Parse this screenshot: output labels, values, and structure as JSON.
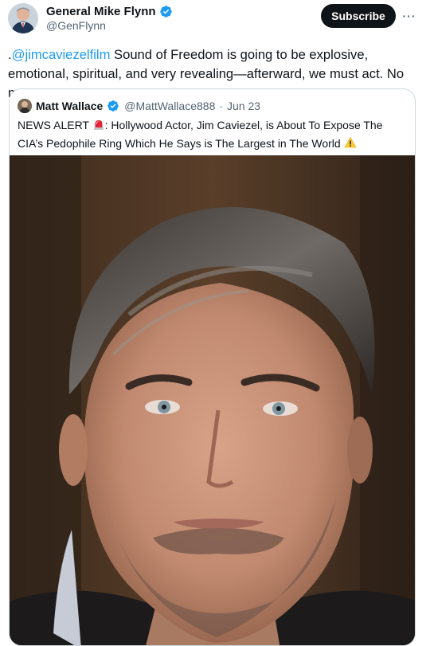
{
  "author": {
    "name": "General Mike Flynn",
    "handle": "@GenFlynn"
  },
  "actions": {
    "subscribe_label": "Subscribe",
    "more_label": "···"
  },
  "tweet": {
    "prefix": ".",
    "mention": "@jimcaviezelfilm",
    "body": " Sound of Freedom is going to be explosive, emotional, spiritual, and very revealing—afterward, we must act. No more excuses."
  },
  "quote": {
    "name": "Matt Wallace",
    "handle": "@MattWallace888",
    "separator": "·",
    "date": "Jun 23",
    "text_before": "NEWS ALERT ",
    "text_middle": ": Hollywood Actor, Jim Caviezel, is About To Expose The CIA’s Pedophile Ring Which He Says is The Largest in The World ",
    "image_description": "close-up portrait photo"
  },
  "icons": {
    "verified": "verified-badge-icon",
    "siren": "police-siren-icon",
    "warning": "warning-icon",
    "more": "more-options-icon"
  },
  "colors": {
    "accent": "#1d9bf0",
    "text": "#0f1419",
    "secondary": "#536471",
    "button_bg": "#0f1419",
    "border": "#cfd9de"
  }
}
